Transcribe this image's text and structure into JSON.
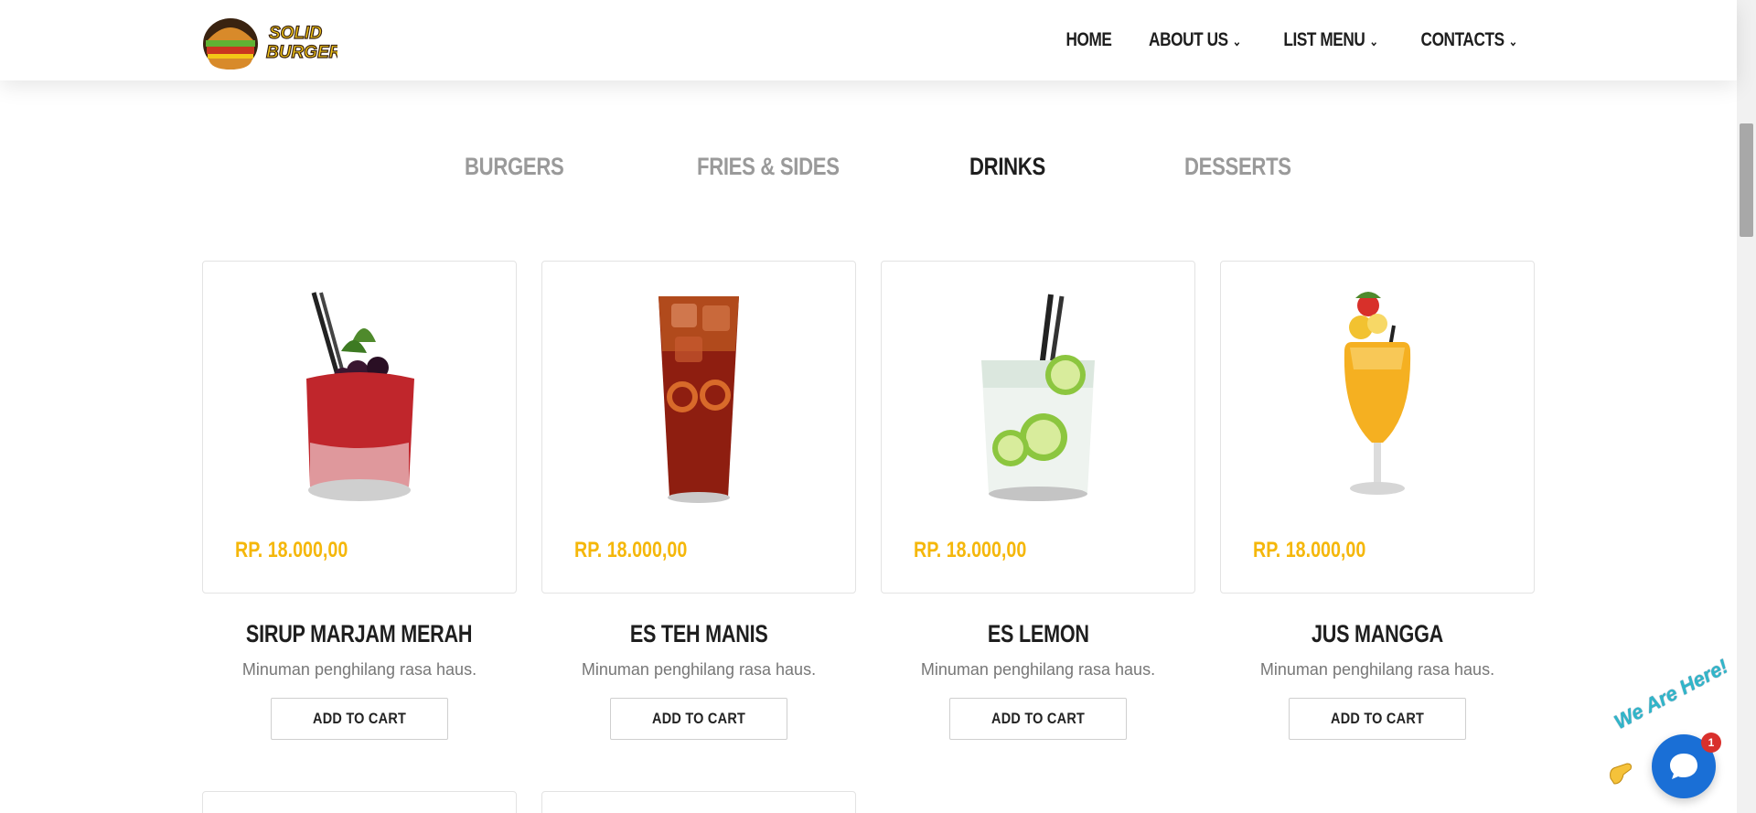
{
  "brand": {
    "logo_text_line1": "SOLID",
    "logo_text_line2": "BURGER"
  },
  "nav": {
    "items": [
      {
        "label": "HOME",
        "has_dropdown": false
      },
      {
        "label": "ABOUT US",
        "has_dropdown": true
      },
      {
        "label": "LIST MENU",
        "has_dropdown": true
      },
      {
        "label": "CONTACTS",
        "has_dropdown": true
      }
    ]
  },
  "tabs": {
    "items": [
      "BURGERS",
      "FRIES & SIDES",
      "DRINKS",
      "DESSERTS"
    ],
    "active": "DRINKS"
  },
  "products": [
    {
      "name": "SIRUP MARJAM MERAH",
      "price": "RP. 18.000,00",
      "description": "Minuman penghilang rasa haus.",
      "button": "ADD TO CART",
      "image": "red-berry-cocktail"
    },
    {
      "name": "ES TEH MANIS",
      "price": "RP. 18.000,00",
      "description": "Minuman penghilang rasa haus.",
      "button": "ADD TO CART",
      "image": "iced-tea-glass"
    },
    {
      "name": "ES LEMON",
      "price": "RP. 18.000,00",
      "description": "Minuman penghilang rasa haus.",
      "button": "ADD TO CART",
      "image": "lime-soda-glass"
    },
    {
      "name": "JUS MANGGA",
      "price": "RP. 18.000,00",
      "description": "Minuman penghilang rasa haus.",
      "button": "ADD TO CART",
      "image": "mango-juice-glass"
    }
  ],
  "chat": {
    "text": "We Are Here!",
    "badge": "1"
  },
  "colors": {
    "accent": "#f5b70a",
    "chat_blue": "#1a6fd6",
    "tab_inactive": "#9a9a9a"
  }
}
